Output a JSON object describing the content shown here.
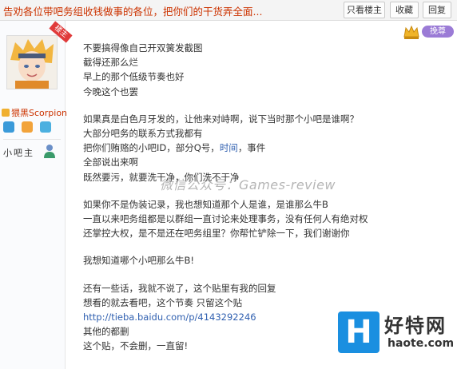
{
  "header": {
    "title": "告劝各位带吧务组收钱做事的各位，把你们的干货弄全面...",
    "buttons": [
      "只看楼主",
      "收藏",
      "回复"
    ]
  },
  "user": {
    "owner_badge": "楼主",
    "username": "猥黑Scorpion",
    "role": "小吧主"
  },
  "decor": {
    "pill": "挽尊"
  },
  "post": {
    "lines_1": [
      "不要搞得像自己开双簧发截图",
      "截得还那么烂",
      "早上的那个低级节奏也好",
      "今晚这个也罢"
    ],
    "lines_2": [
      "如果真是白色月牙发的，让他来对峙啊，说下当时那个小吧是谁啊？",
      "大部分吧务的联系方式我都有"
    ],
    "line_id_pre": "把你们贿赂的小吧ID，部分Q号，",
    "line_id_link": "时间",
    "line_id_post": "，事件",
    "lines_3": [
      "全部说出来啊",
      "既然要污，就要洗干净，你们洗不干净"
    ],
    "lines_4": [
      "如果你不是伪装记录，我也想知道那个人是谁，是谁那么牛B",
      "一直以来吧务组都是以群组一直讨论来处理事务，没有任何人有绝对权",
      "还掌控大权，是不是还在吧务组里？你帮忙铲除一下，我们谢谢你"
    ],
    "line_5": "我想知道哪个小吧那么牛B!",
    "lines_6": [
      "还有一些话，我就不说了，这个贴里有我的回复",
      "想看的就去看吧，这个节奏 只留这个贴"
    ],
    "link_url": "http://tieba.baidu.com/p/4143292246",
    "lines_7": [
      "其他的都删",
      "这个贴，不会删，一直留!"
    ]
  },
  "watermark": "微信公众号：Games-review",
  "logo": {
    "letter": "H",
    "name": "好特网",
    "url": "haote.com"
  },
  "colors": {
    "title": "#cc3300",
    "link": "#3060b0",
    "logo_blue": "#1a8fe0"
  }
}
